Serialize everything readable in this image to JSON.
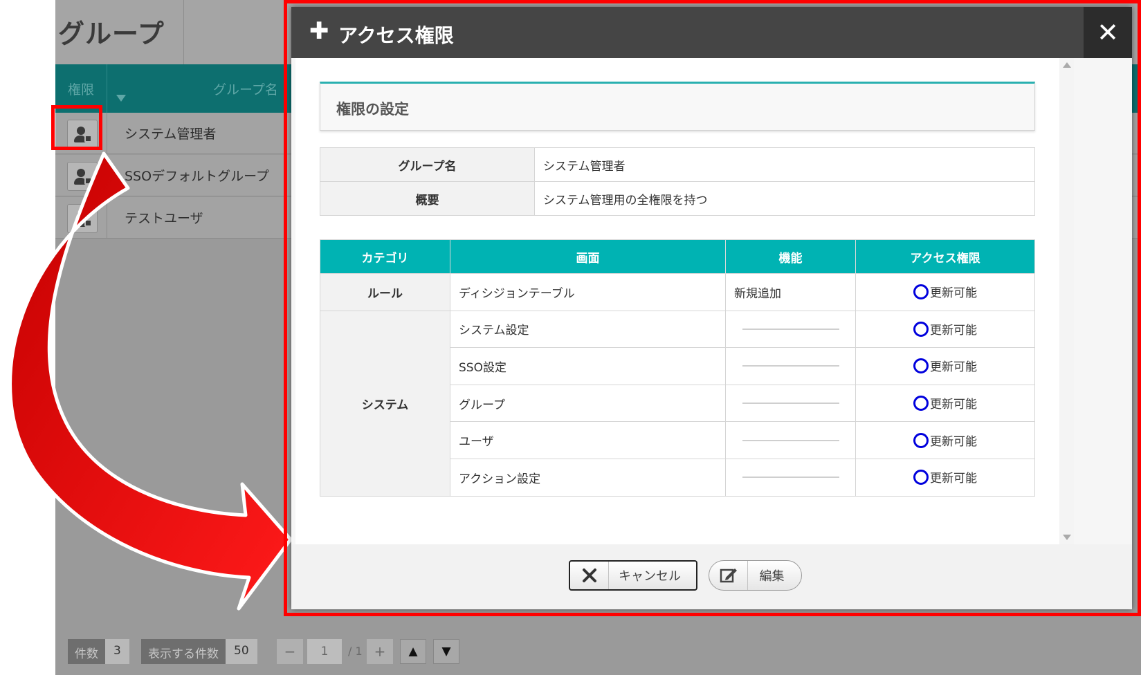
{
  "background": {
    "title": "グループ",
    "columns": {
      "permission": "権限",
      "group_name": "グループ名"
    },
    "rows": [
      {
        "label": "システム管理者"
      },
      {
        "label": "SSOデフォルトグループ"
      },
      {
        "label": "テストユーザ"
      }
    ],
    "footer": {
      "count_label": "件数",
      "count_value": "3",
      "per_page_label": "表示する件数",
      "per_page_value": "50",
      "minus": "−",
      "page": "1",
      "total": "/ 1",
      "plus": "+",
      "up": "▲",
      "down": "▼"
    }
  },
  "modal": {
    "plus_icon": "✚",
    "title": "アクセス権限",
    "close": "✕",
    "section_title": "権限の設定",
    "info": {
      "group_label": "グループ名",
      "group_value": "システム管理者",
      "summary_label": "概要",
      "summary_value": "システム管理用の全権限を持つ"
    },
    "table": {
      "headers": [
        "カテゴリ",
        "画面",
        "機能",
        "アクセス権限"
      ],
      "categories": [
        "ルール",
        "システム"
      ],
      "rows": [
        {
          "screen": "ディシジョンテーブル",
          "function": "新規追加",
          "access": "更新可能"
        },
        {
          "screen": "システム設定",
          "function": "",
          "access": "更新可能"
        },
        {
          "screen": "SSO設定",
          "function": "",
          "access": "更新可能"
        },
        {
          "screen": "グループ",
          "function": "",
          "access": "更新可能"
        },
        {
          "screen": "ユーザ",
          "function": "",
          "access": "更新可能"
        },
        {
          "screen": "アクション設定",
          "function": "",
          "access": "更新可能"
        }
      ]
    },
    "buttons": {
      "cancel": "キャンセル",
      "edit": "編集"
    }
  },
  "colors": {
    "accent_teal": "#00b3b3",
    "highlight_red": "#ff0000",
    "access_mark_blue": "#0000dd"
  }
}
